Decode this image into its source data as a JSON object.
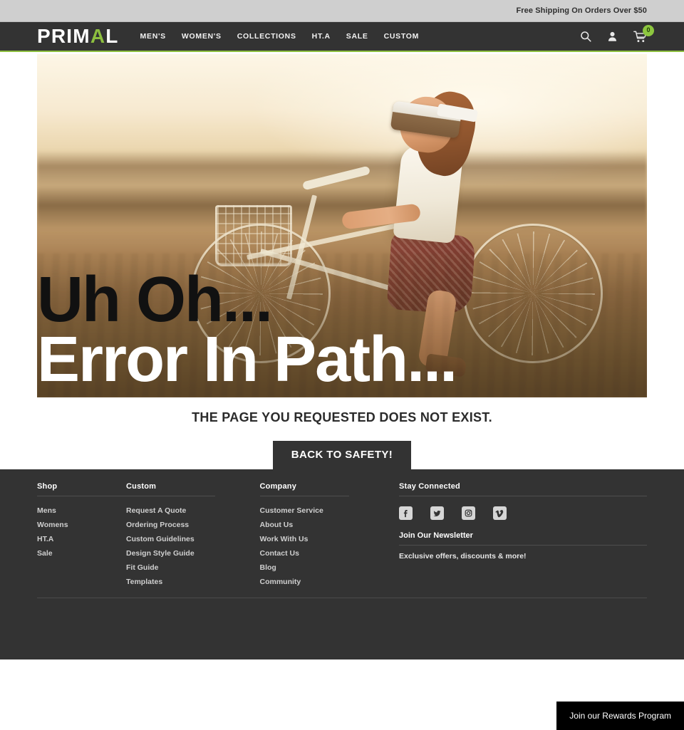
{
  "announcement": {
    "text": "Free Shipping On Orders Over $50"
  },
  "header": {
    "logo_main": "PRIM",
    "logo_accent": "A",
    "logo_tail": "L",
    "nav": [
      {
        "label": "MEN'S"
      },
      {
        "label": "WOMEN'S"
      },
      {
        "label": "COLLECTIONS"
      },
      {
        "label": "HT.A"
      },
      {
        "label": "SALE"
      },
      {
        "label": "CUSTOM"
      }
    ],
    "icons": {
      "search": "search-icon",
      "account": "user-icon",
      "cart": "cart-icon"
    },
    "cart_count": "0",
    "accent_color": "#8dbf3f"
  },
  "hero": {
    "headline_line1": "Uh Oh...",
    "headline_line2": "Error In Path...",
    "image_alt": "Woman wearing a VR headset riding a bicycle at sunset"
  },
  "error": {
    "message": "THE PAGE YOU REQUESTED DOES NOT EXIST.",
    "button_label": "BACK TO SAFETY!"
  },
  "footer": {
    "columns": [
      {
        "title": "Shop",
        "links": [
          {
            "label": "Mens"
          },
          {
            "label": "Womens"
          },
          {
            "label": "HT.A"
          },
          {
            "label": "Sale"
          }
        ]
      },
      {
        "title": "Custom",
        "links": [
          {
            "label": "Request A Quote"
          },
          {
            "label": "Ordering Process"
          },
          {
            "label": "Custom Guidelines"
          },
          {
            "label": "Design Style Guide"
          },
          {
            "label": "Fit Guide"
          },
          {
            "label": "Templates"
          }
        ]
      },
      {
        "title": "Company",
        "links": [
          {
            "label": "Customer Service"
          },
          {
            "label": "About Us"
          },
          {
            "label": "Work With Us"
          },
          {
            "label": "Contact Us"
          },
          {
            "label": "Blog"
          },
          {
            "label": "Community"
          }
        ]
      }
    ],
    "connected": {
      "title": "Stay Connected",
      "social": [
        {
          "name": "facebook-icon",
          "glyph": "f"
        },
        {
          "name": "twitter-icon",
          "glyph": "t"
        },
        {
          "name": "instagram-icon",
          "glyph": "i"
        },
        {
          "name": "vimeo-icon",
          "glyph": "v"
        }
      ],
      "newsletter_title": "Join Our Newsletter",
      "newsletter_text": "Exclusive offers, discounts & more!"
    }
  },
  "rewards": {
    "label": "Join our Rewards Program"
  }
}
